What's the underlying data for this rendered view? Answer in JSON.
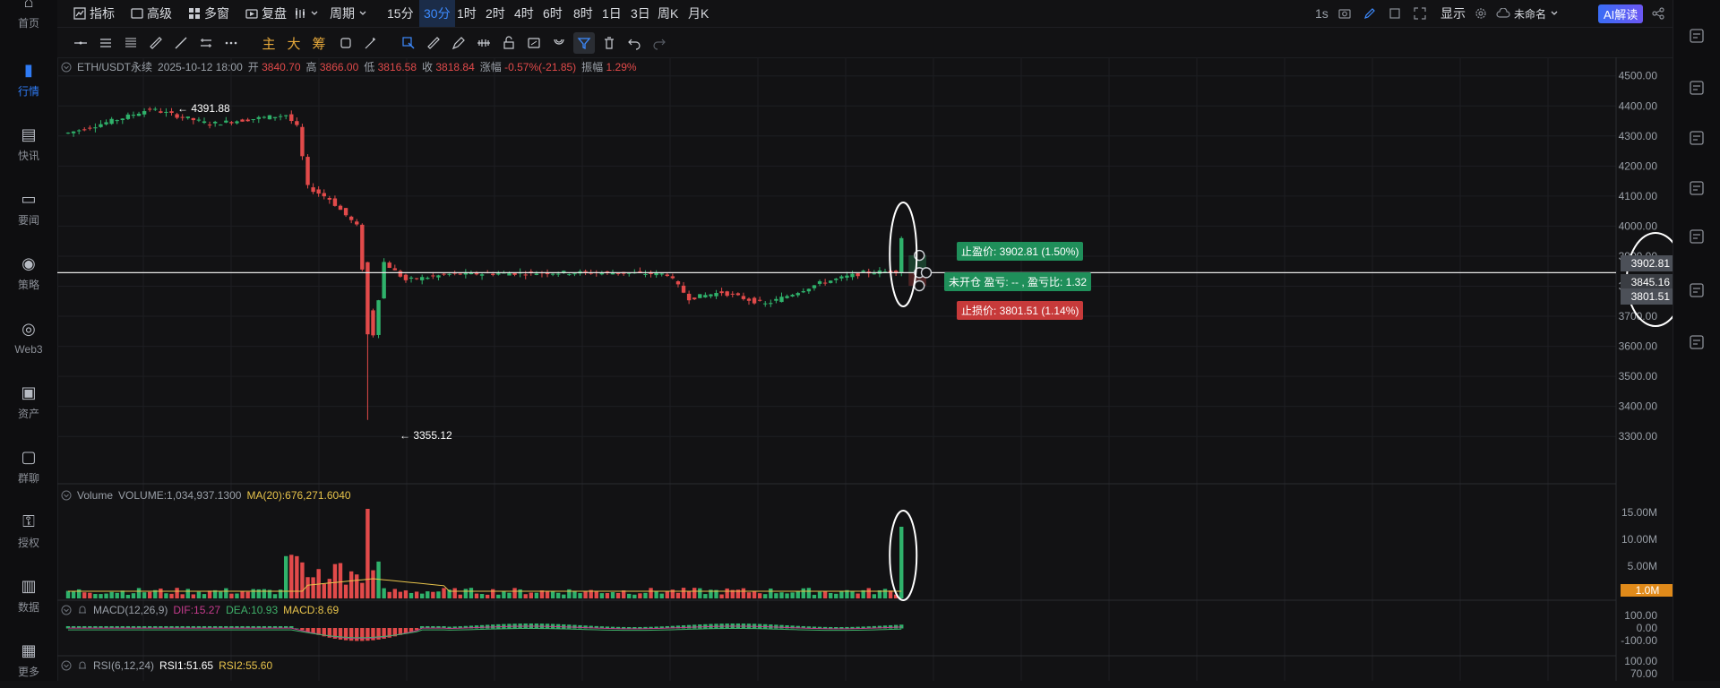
{
  "leftnav": {
    "items": [
      {
        "label": "首页",
        "icon": "home-icon"
      },
      {
        "label": "行情",
        "icon": "chart-bars-icon",
        "active": true
      },
      {
        "label": "快讯",
        "icon": "news-icon"
      },
      {
        "label": "要闻",
        "icon": "document-icon"
      },
      {
        "label": "策略",
        "icon": "robot-icon"
      },
      {
        "label": "Web3",
        "icon": "web3-icon"
      },
      {
        "label": "资产",
        "icon": "wallet-icon"
      },
      {
        "label": "群聊",
        "icon": "chat-icon"
      },
      {
        "label": "授权",
        "icon": "key-icon"
      },
      {
        "label": "数据",
        "icon": "data-icon"
      },
      {
        "label": "更多",
        "icon": "grid-icon"
      }
    ]
  },
  "toolbar": {
    "indicators": "指标",
    "advanced": "高级",
    "multi_window": "多窗",
    "replay": "复盘",
    "period": "周期",
    "intervals": [
      "15分",
      "30分",
      "1时",
      "2时",
      "4时",
      "6时",
      "8时",
      "1日",
      "3日",
      "周K",
      "月K"
    ],
    "selected_interval": "30分",
    "refresh": "1s",
    "display": "显示",
    "layout_name": "未命名",
    "ai": "AI解读"
  },
  "drawbar": {
    "main": "主",
    "big": "大",
    "chips": "筹"
  },
  "legend": {
    "symbol": "ETH/USDT永续",
    "time": "2025-10-12 18:00",
    "open_label": "开",
    "open": "3840.70",
    "high_label": "高",
    "high": "3866.00",
    "low_label": "低",
    "low": "3816.58",
    "close_label": "收",
    "close": "3818.84",
    "change_label": "涨幅",
    "change": "-0.57%(-21.85)",
    "amp_label": "振幅",
    "amp": "1.29%"
  },
  "annotations": {
    "high_mark": "← 4391.88",
    "low_mark": "← 3355.12"
  },
  "position": {
    "take_profit": "止盈价: 3902.81 (1.50%)",
    "status": "未开仓 盈亏: -- , 盈亏比: 1.32",
    "stop_loss": "止损价: 3801.51 (1.14%)",
    "tp_price": "3902.81",
    "entry_price": "3845.16",
    "sl_price": "3801.51"
  },
  "price_axis": [
    "4500.00",
    "4400.00",
    "4300.00",
    "4200.00",
    "4100.00",
    "4000.00",
    "3900.00",
    "3800.00",
    "3700.00",
    "3600.00",
    "3500.00",
    "3400.00",
    "3300.00"
  ],
  "volume": {
    "label": "Volume",
    "value": "VOLUME:1,034,937.1300",
    "ma": "MA(20):676,271.6040",
    "axis": [
      "15.00M",
      "10.00M",
      "5.00M"
    ],
    "current_tag": "1.0M"
  },
  "macd": {
    "label": "MACD(12,26,9)",
    "dif": "DIF:15.27",
    "dea": "DEA:10.93",
    "macd": "MACD:8.69",
    "axis": [
      "100.00",
      "0.00",
      "-100.00"
    ]
  },
  "rsi": {
    "label": "RSI(6,12,24)",
    "rsi1": "RSI1:51.65",
    "rsi2": "RSI2:55.60",
    "axis": [
      "100.00",
      "70.00"
    ]
  },
  "colors": {
    "up": "#2fb26b",
    "down": "#e14a4a",
    "bg": "#121214",
    "accent": "#2f7bf5"
  },
  "chart_data": {
    "type": "candlestick",
    "title": "ETH/USDT永续",
    "ylim": [
      3250,
      4520
    ],
    "summary": {
      "high": 4391.88,
      "low": 3355.12,
      "last_bar": {
        "open": 3840.7,
        "high": 3866.0,
        "low": 3816.58,
        "close": 3818.84
      }
    },
    "key_points": [
      [
        0,
        4310
      ],
      [
        10,
        4360
      ],
      [
        15,
        4390
      ],
      [
        26,
        4340
      ],
      [
        40,
        4370
      ],
      [
        42,
        4330
      ],
      [
        44,
        4130
      ],
      [
        48,
        4090
      ],
      [
        53,
        4000
      ],
      [
        55,
        3720
      ],
      [
        56,
        3640
      ],
      [
        58,
        3880
      ],
      [
        62,
        3820
      ],
      [
        70,
        3840
      ],
      [
        88,
        3845
      ],
      [
        100,
        3845
      ],
      [
        110,
        3840
      ],
      [
        114,
        3760
      ],
      [
        120,
        3780
      ],
      [
        128,
        3740
      ],
      [
        138,
        3810
      ],
      [
        146,
        3845
      ],
      [
        152,
        3850
      ],
      [
        153,
        3960
      ]
    ]
  }
}
